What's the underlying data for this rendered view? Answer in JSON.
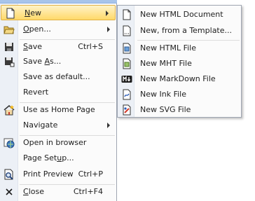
{
  "main_menu": [
    {
      "key": "new",
      "pre": "",
      "ul": "N",
      "post": "ew",
      "shortcut": "",
      "icon": "new-document-icon"
    },
    {
      "key": "open",
      "pre": "",
      "ul": "O",
      "post": "pen...",
      "shortcut": "",
      "icon": "open-folder-icon"
    },
    {
      "key": "save",
      "pre": "",
      "ul": "S",
      "post": "ave",
      "shortcut": "Ctrl+S",
      "icon": "save-disk-icon"
    },
    {
      "key": "save_as",
      "pre": "Save ",
      "ul": "A",
      "post": "s...",
      "shortcut": "",
      "icon": "save-as-icon"
    },
    {
      "key": "save_default",
      "pre": "Save as default...",
      "ul": "",
      "post": "",
      "shortcut": ""
    },
    {
      "key": "revert",
      "pre": "Revert",
      "ul": "",
      "post": "",
      "shortcut": ""
    },
    {
      "key": "home",
      "pre": "Use as Home Page",
      "ul": "",
      "post": "",
      "shortcut": "",
      "icon": "home-page-icon"
    },
    {
      "key": "navigate",
      "pre": "Navigate",
      "ul": "",
      "post": "",
      "shortcut": ""
    },
    {
      "key": "browser",
      "pre": "Open in browser",
      "ul": "",
      "post": "",
      "shortcut": "",
      "icon": "browser-globe-icon"
    },
    {
      "key": "page_setup",
      "pre": "Page Set",
      "ul": "u",
      "post": "p...",
      "shortcut": ""
    },
    {
      "key": "print_preview",
      "pre": "Print Preview",
      "ul": "",
      "post": "",
      "shortcut": "Ctrl+P",
      "icon": "print-preview-icon"
    },
    {
      "key": "close",
      "pre": "",
      "ul": "C",
      "post": "lose",
      "shortcut": "Ctrl+F4",
      "icon": "close-x-icon"
    }
  ],
  "submenu": [
    {
      "label": "New HTML Document",
      "icon": "blank-page-icon"
    },
    {
      "label": "New, from a Template...",
      "icon": "template-page-icon"
    },
    {
      "label": "New HTML File",
      "icon": "html-file-icon"
    },
    {
      "label": "New MHT File",
      "icon": "mht-file-icon"
    },
    {
      "label": "New MarkDown File",
      "icon": "markdown-icon"
    },
    {
      "label": "New Ink File",
      "icon": "ink-file-icon"
    },
    {
      "label": "New SVG File",
      "icon": "svg-file-icon"
    }
  ],
  "colors": {
    "highlight_top": "#fff3c8",
    "highlight_bottom": "#ffd969",
    "gutter": "#ecf0f6"
  }
}
